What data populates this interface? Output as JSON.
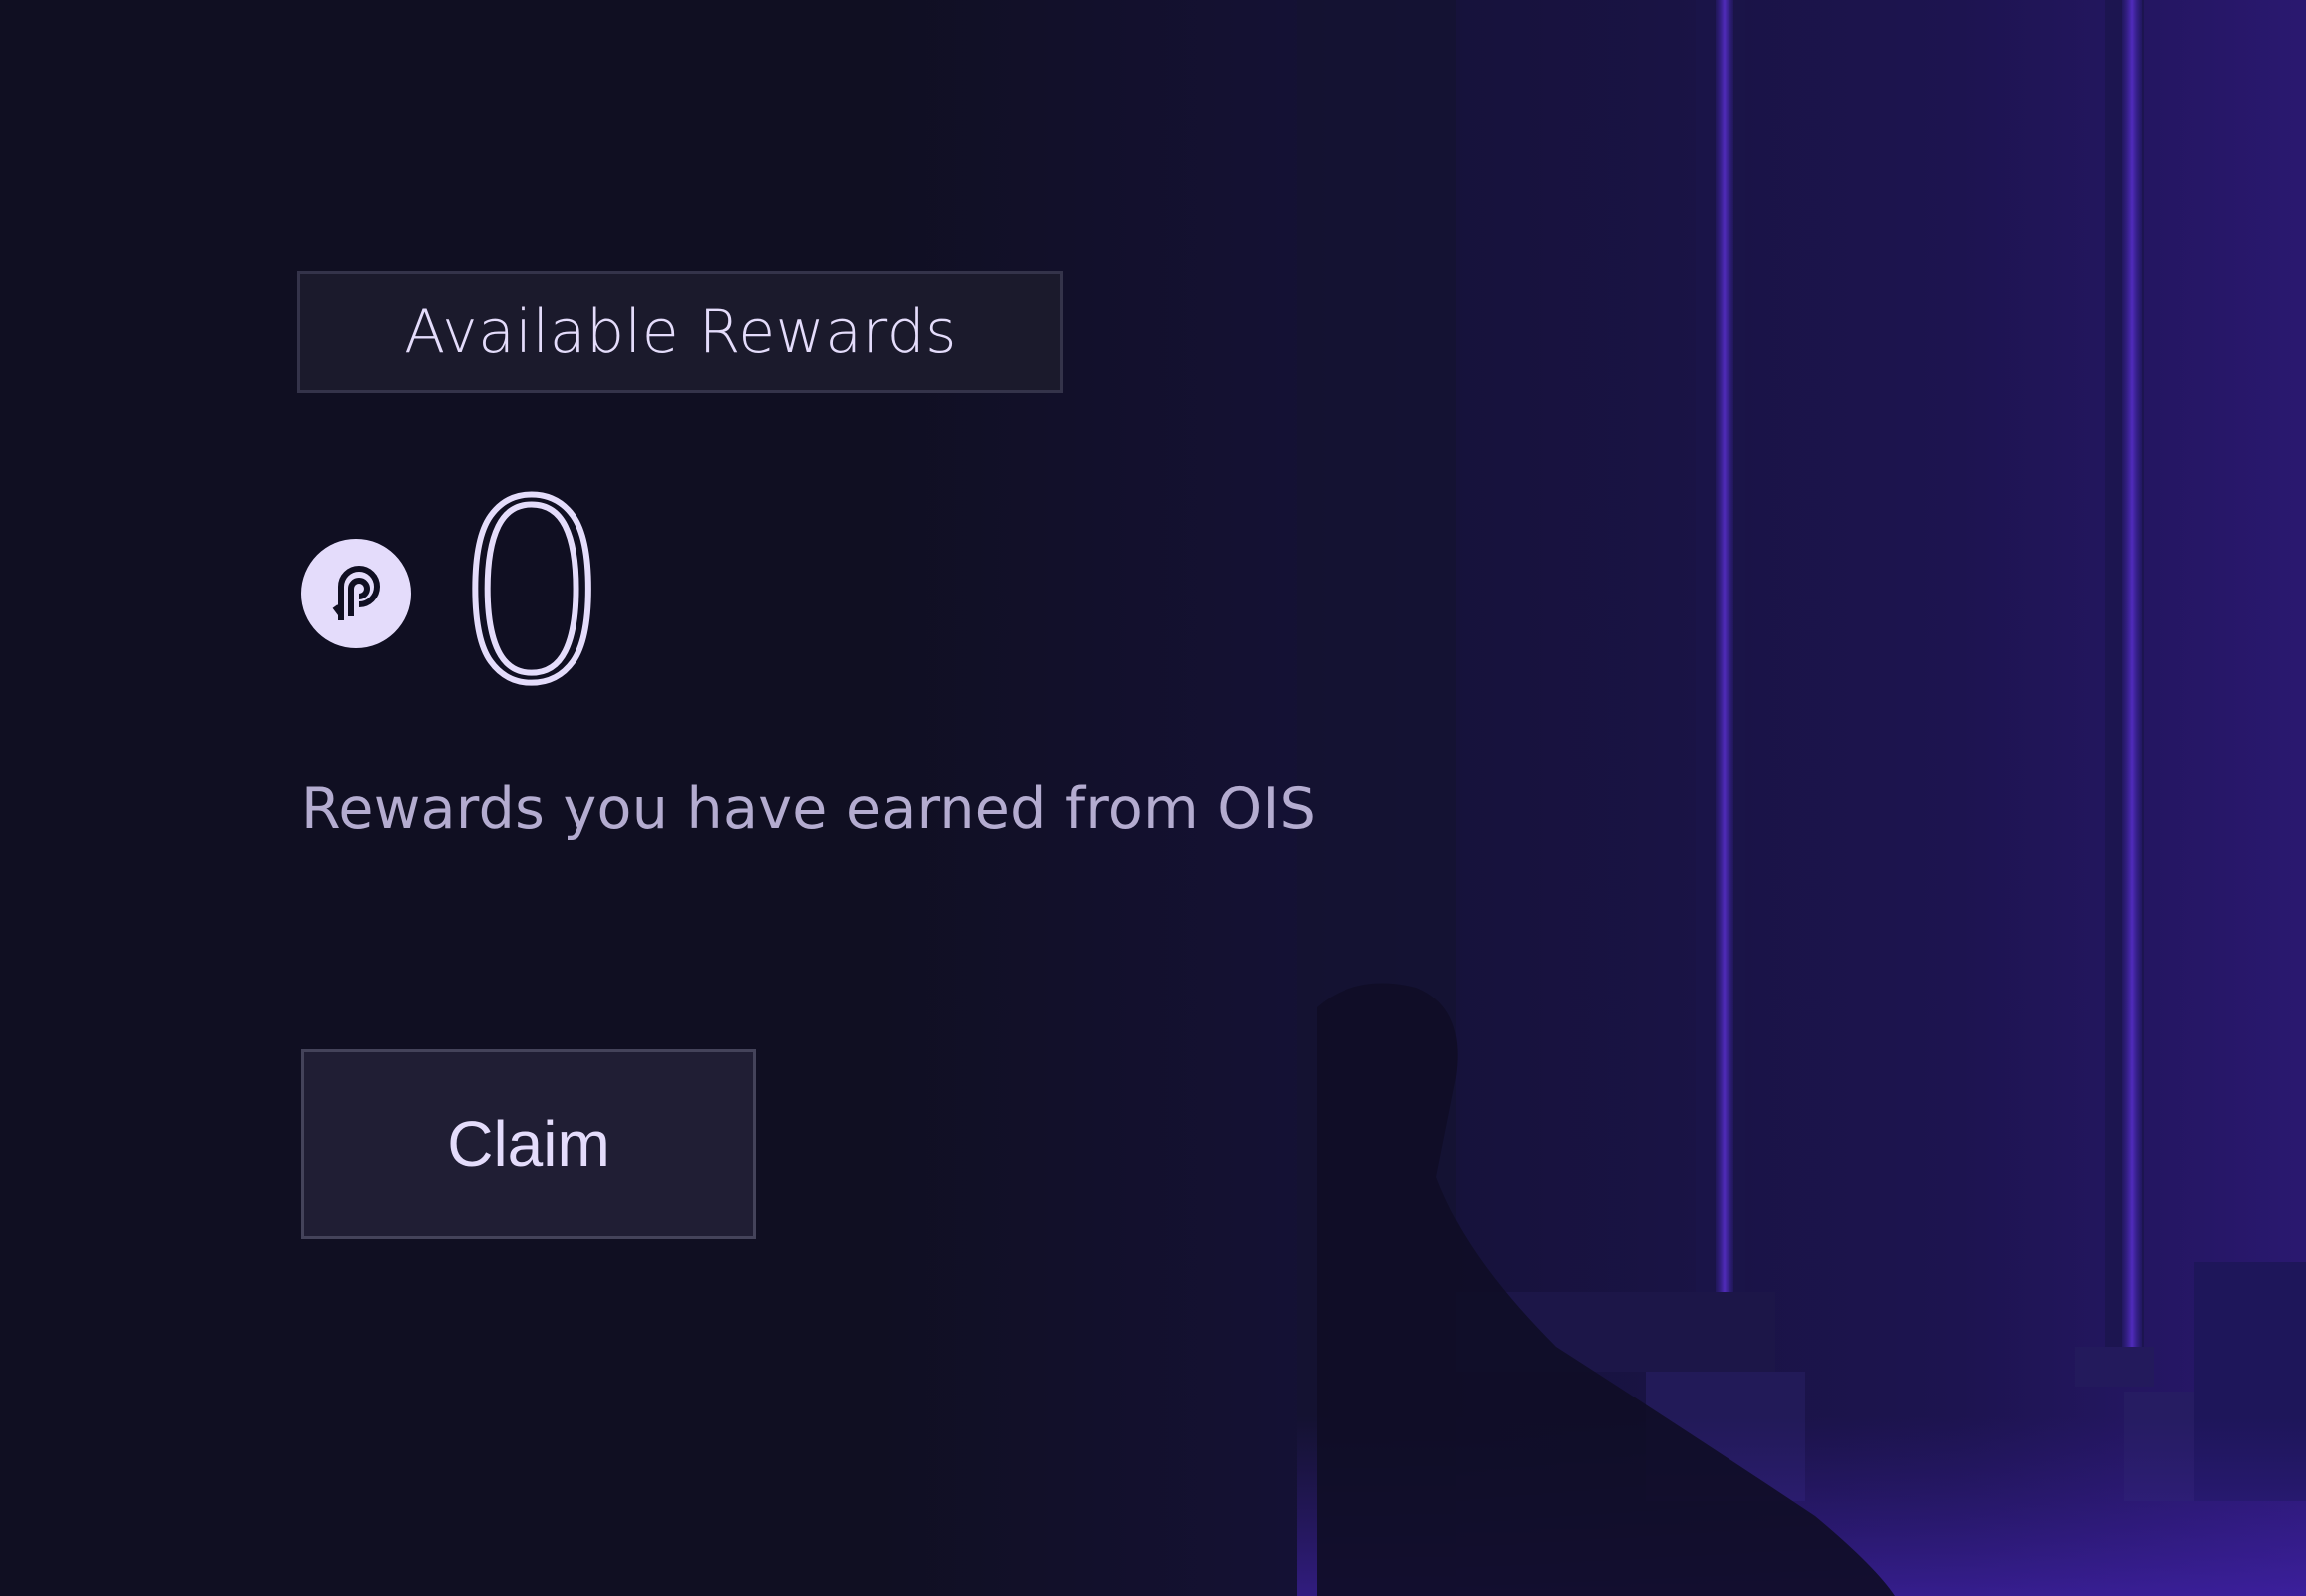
{
  "rewards": {
    "header_label": "Available Rewards",
    "balance": "0",
    "token_icon": "pyth-token-icon",
    "description": "Rewards you have earned from OIS",
    "claim_label": "Claim"
  },
  "colors": {
    "background": "#100f22",
    "text_primary": "#e4dcfb",
    "text_secondary": "#b4acd0",
    "accent_purple": "#5b2fd0"
  }
}
